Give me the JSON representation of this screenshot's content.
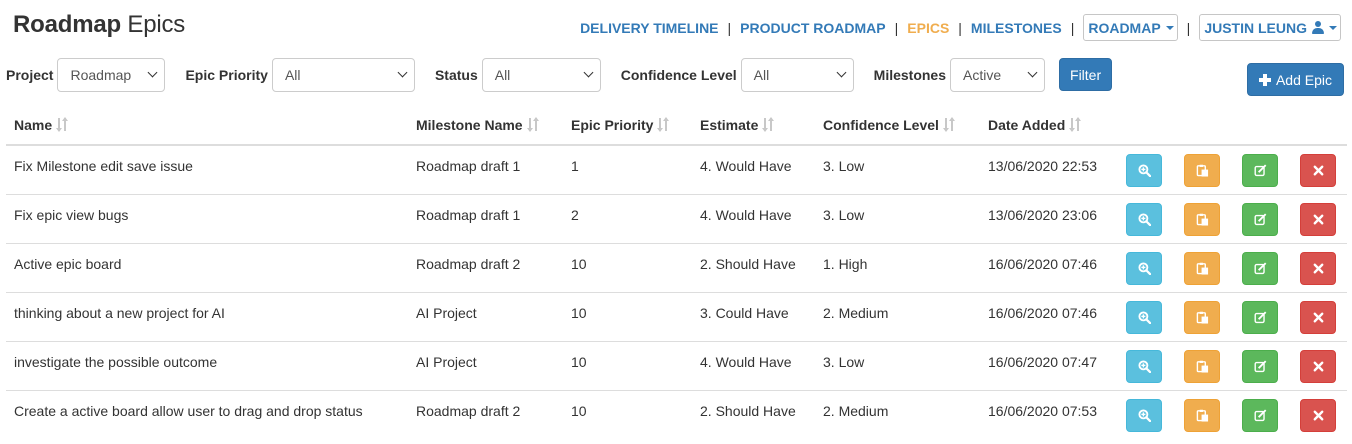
{
  "header": {
    "title_bold": "Roadmap",
    "title_rest": "Epics"
  },
  "nav": {
    "links": [
      {
        "label": "DELIVERY TIMELINE",
        "active": false
      },
      {
        "label": "PRODUCT ROADMAP",
        "active": false
      },
      {
        "label": "EPICS",
        "active": true
      },
      {
        "label": "MILESTONES",
        "active": false
      }
    ],
    "project_dropdown": "ROADMAP",
    "user_dropdown": "JUSTIN LEUNG"
  },
  "filters": {
    "project": {
      "label": "Project",
      "value": "Roadmap"
    },
    "epic_priority": {
      "label": "Epic Priority",
      "value": "All"
    },
    "status": {
      "label": "Status",
      "value": "All"
    },
    "confidence_level": {
      "label": "Confidence Level",
      "value": "All"
    },
    "milestones": {
      "label": "Milestones",
      "value": "Active"
    },
    "filter_button": "Filter",
    "add_button": "Add Epic"
  },
  "table": {
    "headers": {
      "name": "Name",
      "milestone": "Milestone Name",
      "priority": "Epic Priority",
      "estimate": "Estimate",
      "confidence": "Confidence Level",
      "date": "Date Added"
    },
    "rows": [
      {
        "name": "Fix Milestone edit save issue",
        "milestone": "Roadmap draft 1",
        "priority": "1",
        "estimate": "4. Would Have",
        "confidence": "3. Low",
        "date": "13/06/2020 22:53"
      },
      {
        "name": "Fix epic view bugs",
        "milestone": "Roadmap draft 1",
        "priority": "2",
        "estimate": "4. Would Have",
        "confidence": "3. Low",
        "date": "13/06/2020 23:06"
      },
      {
        "name": "Active epic board",
        "milestone": "Roadmap draft 2",
        "priority": "10",
        "estimate": "2. Should Have",
        "confidence": "1. High",
        "date": "16/06/2020 07:46"
      },
      {
        "name": "thinking about a new project for AI",
        "milestone": "AI Project",
        "priority": "10",
        "estimate": "3. Could Have",
        "confidence": "2. Medium",
        "date": "16/06/2020 07:46"
      },
      {
        "name": "investigate the possible outcome",
        "milestone": "AI Project",
        "priority": "10",
        "estimate": "4. Would Have",
        "confidence": "3. Low",
        "date": "16/06/2020 07:47"
      },
      {
        "name": "Create a active board allow user to drag and drop status",
        "milestone": "Roadmap draft 2",
        "priority": "10",
        "estimate": "2. Should Have",
        "confidence": "2. Medium",
        "date": "16/06/2020 07:53"
      }
    ]
  },
  "colors": {
    "primary": "#337ab7",
    "active_nav": "#f0ad4e",
    "info": "#5bc0de",
    "warning": "#f0ad4e",
    "success": "#5cb85c",
    "danger": "#d9534f"
  },
  "icons": {
    "view": "search-plus-icon",
    "copy": "copy-icon",
    "edit": "edit-icon",
    "delete": "remove-icon"
  }
}
